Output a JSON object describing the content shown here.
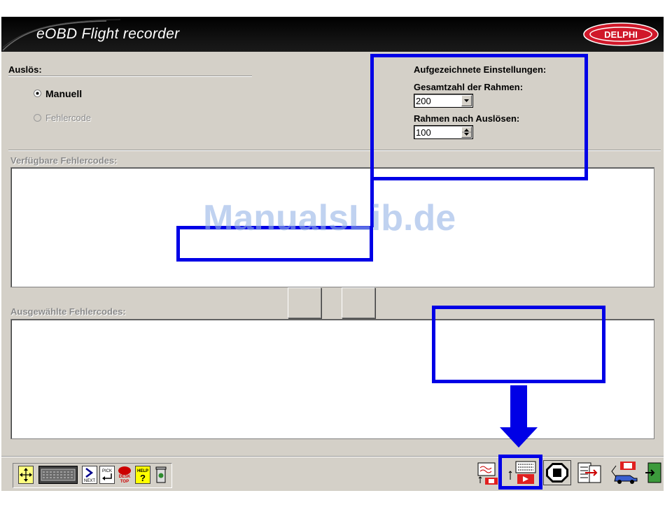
{
  "app": {
    "title": "eOBD Flight recorder",
    "brand": "DELPHI",
    "brand_color": "#d0182a"
  },
  "trigger": {
    "heading": "Auslös:",
    "options": [
      {
        "label": "Manuell",
        "selected": true,
        "enabled": true
      },
      {
        "label": "Fehlercode",
        "selected": false,
        "enabled": false
      }
    ]
  },
  "recorded_settings": {
    "heading": "Aufgezeichnete Einstellungen:",
    "total_frames_label": "Gesamtzahl der Rahmen:",
    "total_frames_value": "200",
    "frames_after_trigger_label": "Rahmen nach Auslösen:",
    "frames_after_trigger_value": "100"
  },
  "available_codes": {
    "label": "Verfügbare Fehlercodes:",
    "items": []
  },
  "selected_codes": {
    "label": "Ausgewählte Fehlercodes:",
    "items": []
  },
  "watermark": "ManualsLib.de",
  "toolbar_left": [
    "move-cursor-icon",
    "keyboard-icon",
    "next-icon",
    "pick-icon",
    "desktop-icon",
    "help-icon",
    "trash-icon"
  ],
  "toolbar_left_labels": {
    "next": "NEXT",
    "pick": "PICK",
    "desk": "DESK",
    "top": "TOP",
    "help": "HELP",
    "help_q": "?"
  },
  "toolbar_right": [
    "signal-record-icon",
    "frame-record-icon",
    "stop-icon",
    "data-list-icon",
    "vehicle-connect-icon",
    "exit-icon"
  ],
  "annotation_color": "#0000e6"
}
